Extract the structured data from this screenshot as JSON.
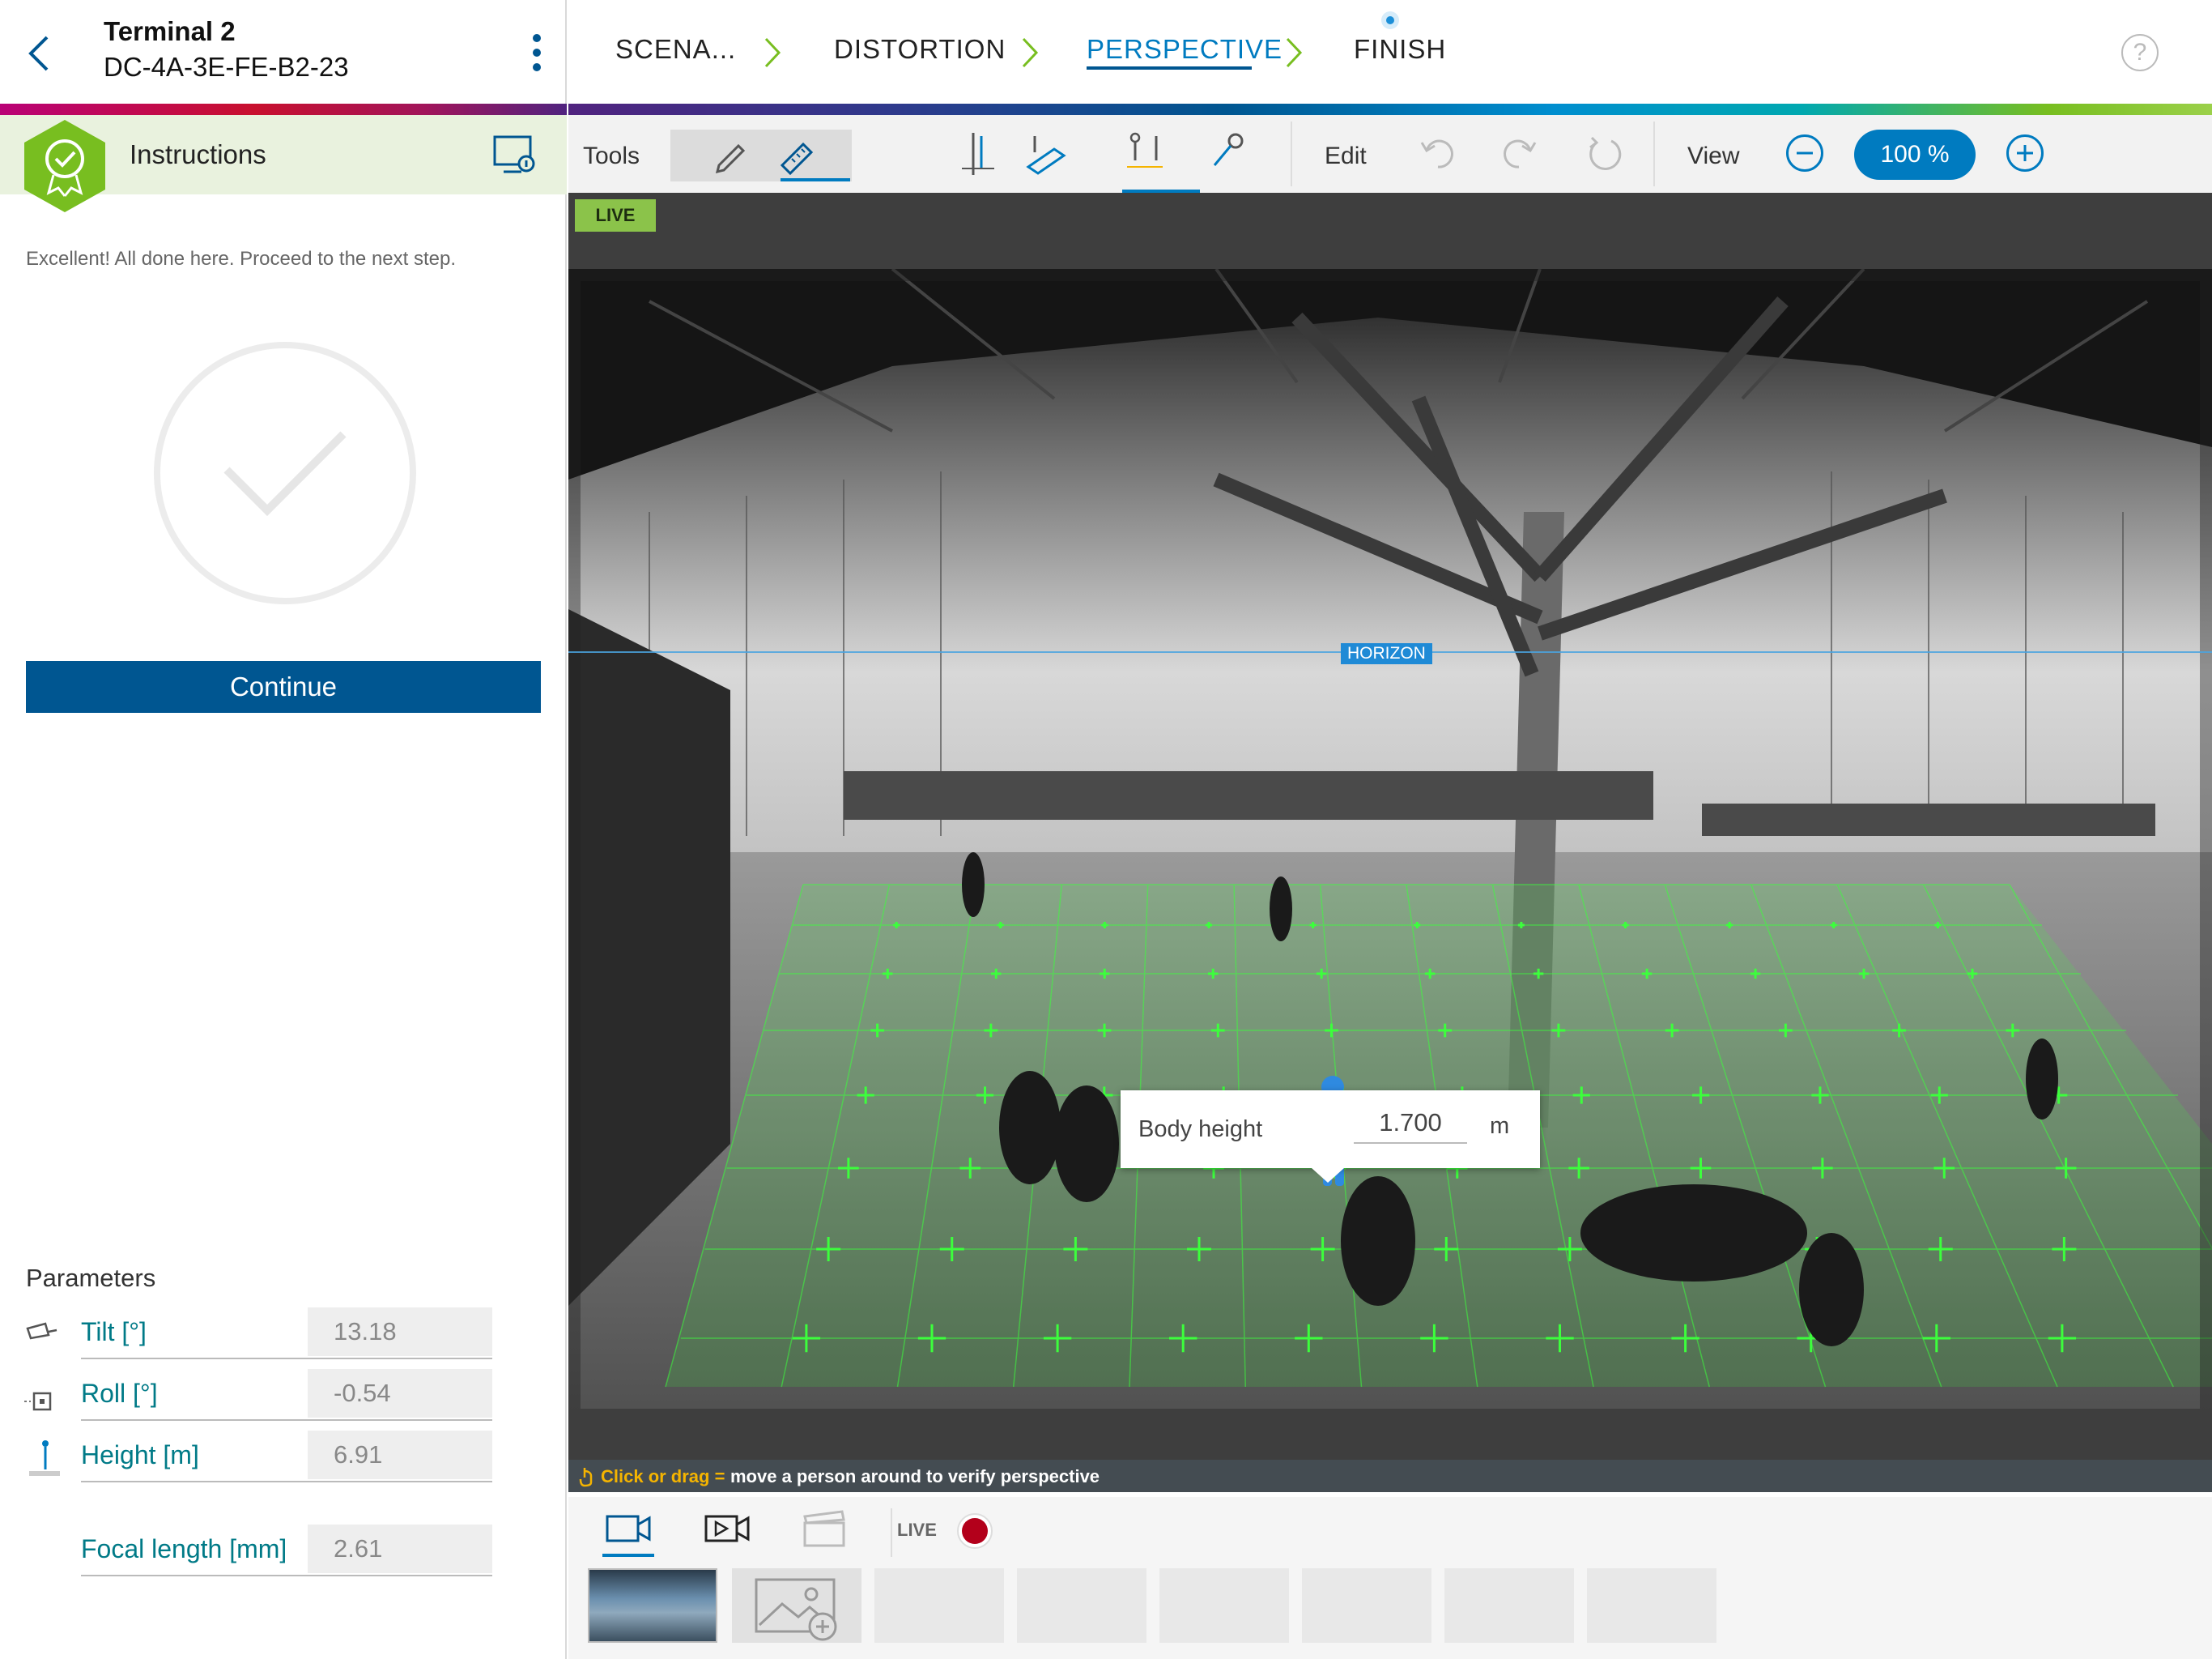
{
  "device": {
    "title": "Terminal 2",
    "id": "DC-4A-3E-FE-B2-23"
  },
  "instructions": {
    "title": "Instructions",
    "text": "Excellent! All done here. Proceed to the next step.",
    "continue_label": "Continue"
  },
  "parameters": {
    "title": "Parameters",
    "items": [
      {
        "label": "Tilt [°]",
        "value": "13.18",
        "icon": "camera-tilt-icon"
      },
      {
        "label": "Roll [°]",
        "value": "-0.54",
        "icon": "roll-icon"
      },
      {
        "label": "Height [m]",
        "value": "6.91",
        "icon": "height-icon"
      },
      {
        "label": "Focal length [mm]",
        "value": "2.61",
        "icon": ""
      }
    ]
  },
  "steps": [
    {
      "label": "SCENA..."
    },
    {
      "label": "DISTORTION"
    },
    {
      "label": "PERSPECTIVE",
      "active": true
    },
    {
      "label": "FINISH"
    }
  ],
  "help_symbol": "?",
  "toolbar": {
    "tools_label": "Tools",
    "edit_label": "Edit",
    "view_label": "View",
    "zoom": "100 %"
  },
  "viewport": {
    "live_tag": "LIVE",
    "horizon_label": "HORIZON",
    "body_height": {
      "label": "Body height",
      "value": "1.700",
      "unit": "m"
    },
    "hint": {
      "emphasis": "Click or drag =",
      "text": "move a person around to verify perspective"
    }
  },
  "bottom": {
    "live_label": "LIVE"
  },
  "colors": {
    "primary": "#005691",
    "accent": "#007bc0",
    "success": "#78be20",
    "record": "#b3001b",
    "grid": "#3cff3c"
  }
}
